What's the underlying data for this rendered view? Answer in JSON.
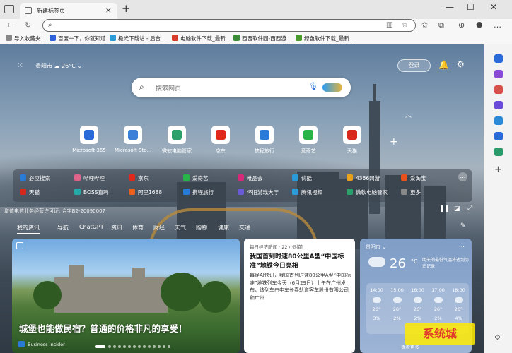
{
  "tab": {
    "title": "新建标签页"
  },
  "address": {
    "value": ""
  },
  "bookmarks": [
    {
      "label": "导入收藏夹",
      "color": "#888888"
    },
    {
      "label": "百度一下，你就知道",
      "color": "#2f5fd8"
    },
    {
      "label": "极光下载站 - 后台...",
      "color": "#2c9cd8"
    },
    {
      "label": "电脑软件下载_最新...",
      "color": "#d83a2c"
    },
    {
      "label": "西西软件园-西西游...",
      "color": "#3a8a3a"
    },
    {
      "label": "绿色软件下载_最新...",
      "color": "#4b9a2e"
    }
  ],
  "top": {
    "city": "贵阳市",
    "temp": "26°C",
    "login": "登录"
  },
  "search": {
    "placeholder": "搜索网页"
  },
  "tiles": [
    {
      "label": "Microsoft 365",
      "color": "#2a6ad8"
    },
    {
      "label": "Microsoft Sto...",
      "color": "#3a80d8"
    },
    {
      "label": "微软电脑管家",
      "color": "#2ba06a"
    },
    {
      "label": "京东",
      "color": "#e0281c"
    },
    {
      "label": "携程旅行",
      "color": "#2a7ad8"
    },
    {
      "label": "爱奇艺",
      "color": "#28b448"
    },
    {
      "label": "天猫",
      "color": "#d8281c"
    }
  ],
  "links": [
    {
      "label": "必应搜索",
      "color": "#2a7ad8"
    },
    {
      "label": "哔哩哔哩",
      "color": "#e2638a"
    },
    {
      "label": "京东",
      "color": "#e0281c"
    },
    {
      "label": "爱奇艺",
      "color": "#28b448"
    },
    {
      "label": "唯品会",
      "color": "#d8287a"
    },
    {
      "label": "优酷",
      "color": "#2a9ad8"
    },
    {
      "label": "4366网游",
      "color": "#e8a21c"
    },
    {
      "label": "爱淘宝",
      "color": "#e8501c"
    },
    {
      "label": "天猫",
      "color": "#d8281c"
    },
    {
      "label": "BOSS直聘",
      "color": "#28a8a8"
    },
    {
      "label": "阿里1688",
      "color": "#e8601c"
    },
    {
      "label": "携程旅行",
      "color": "#2a7ad8"
    },
    {
      "label": "怀旧游戏大厅",
      "color": "#6a5ad8"
    },
    {
      "label": "腾讯视频",
      "color": "#2a9ad8"
    },
    {
      "label": "微软电脑管家",
      "color": "#2ba06a"
    },
    {
      "label": "更多",
      "color": "#888888"
    }
  ],
  "icp": "增值电信业务经营许可证: 合字B2-20090007",
  "feed_tabs": [
    "我的资讯",
    "导航",
    "ChatGPT",
    "资讯",
    "体育",
    "财经",
    "天气",
    "购物",
    "健康",
    "交通"
  ],
  "hero": {
    "title": "城堡也能做民宿？普通的价格非凡的享受！",
    "source": "Business Insider"
  },
  "news": {
    "source": "每日经济新闻 · 22 小时前",
    "title": "我国首列时速80公里A型“中国标准”地铁今日亮相",
    "body": "每经AI快讯，我国首列时速80公里A型“中国标准”地铁列车今天（6月29日）上午在广州发布，该列车由中车长春轨道客车股份有限公司和广州..."
  },
  "weather": {
    "city": "贵阳市",
    "temp": "26",
    "unit": "°C",
    "desc": "明天的最低气温将达到历史记录",
    "hours": [
      {
        "time": "14:00",
        "temp": "26°",
        "rain": "3%"
      },
      {
        "time": "15:00",
        "temp": "26°",
        "rain": "2%"
      },
      {
        "time": "16:00",
        "temp": "26°",
        "rain": "2%"
      },
      {
        "time": "17:00",
        "temp": "26°",
        "rain": "2%"
      },
      {
        "time": "18:00",
        "temp": "26°",
        "rain": "4%"
      }
    ],
    "more": "查看更多"
  },
  "watermark": "系统城"
}
